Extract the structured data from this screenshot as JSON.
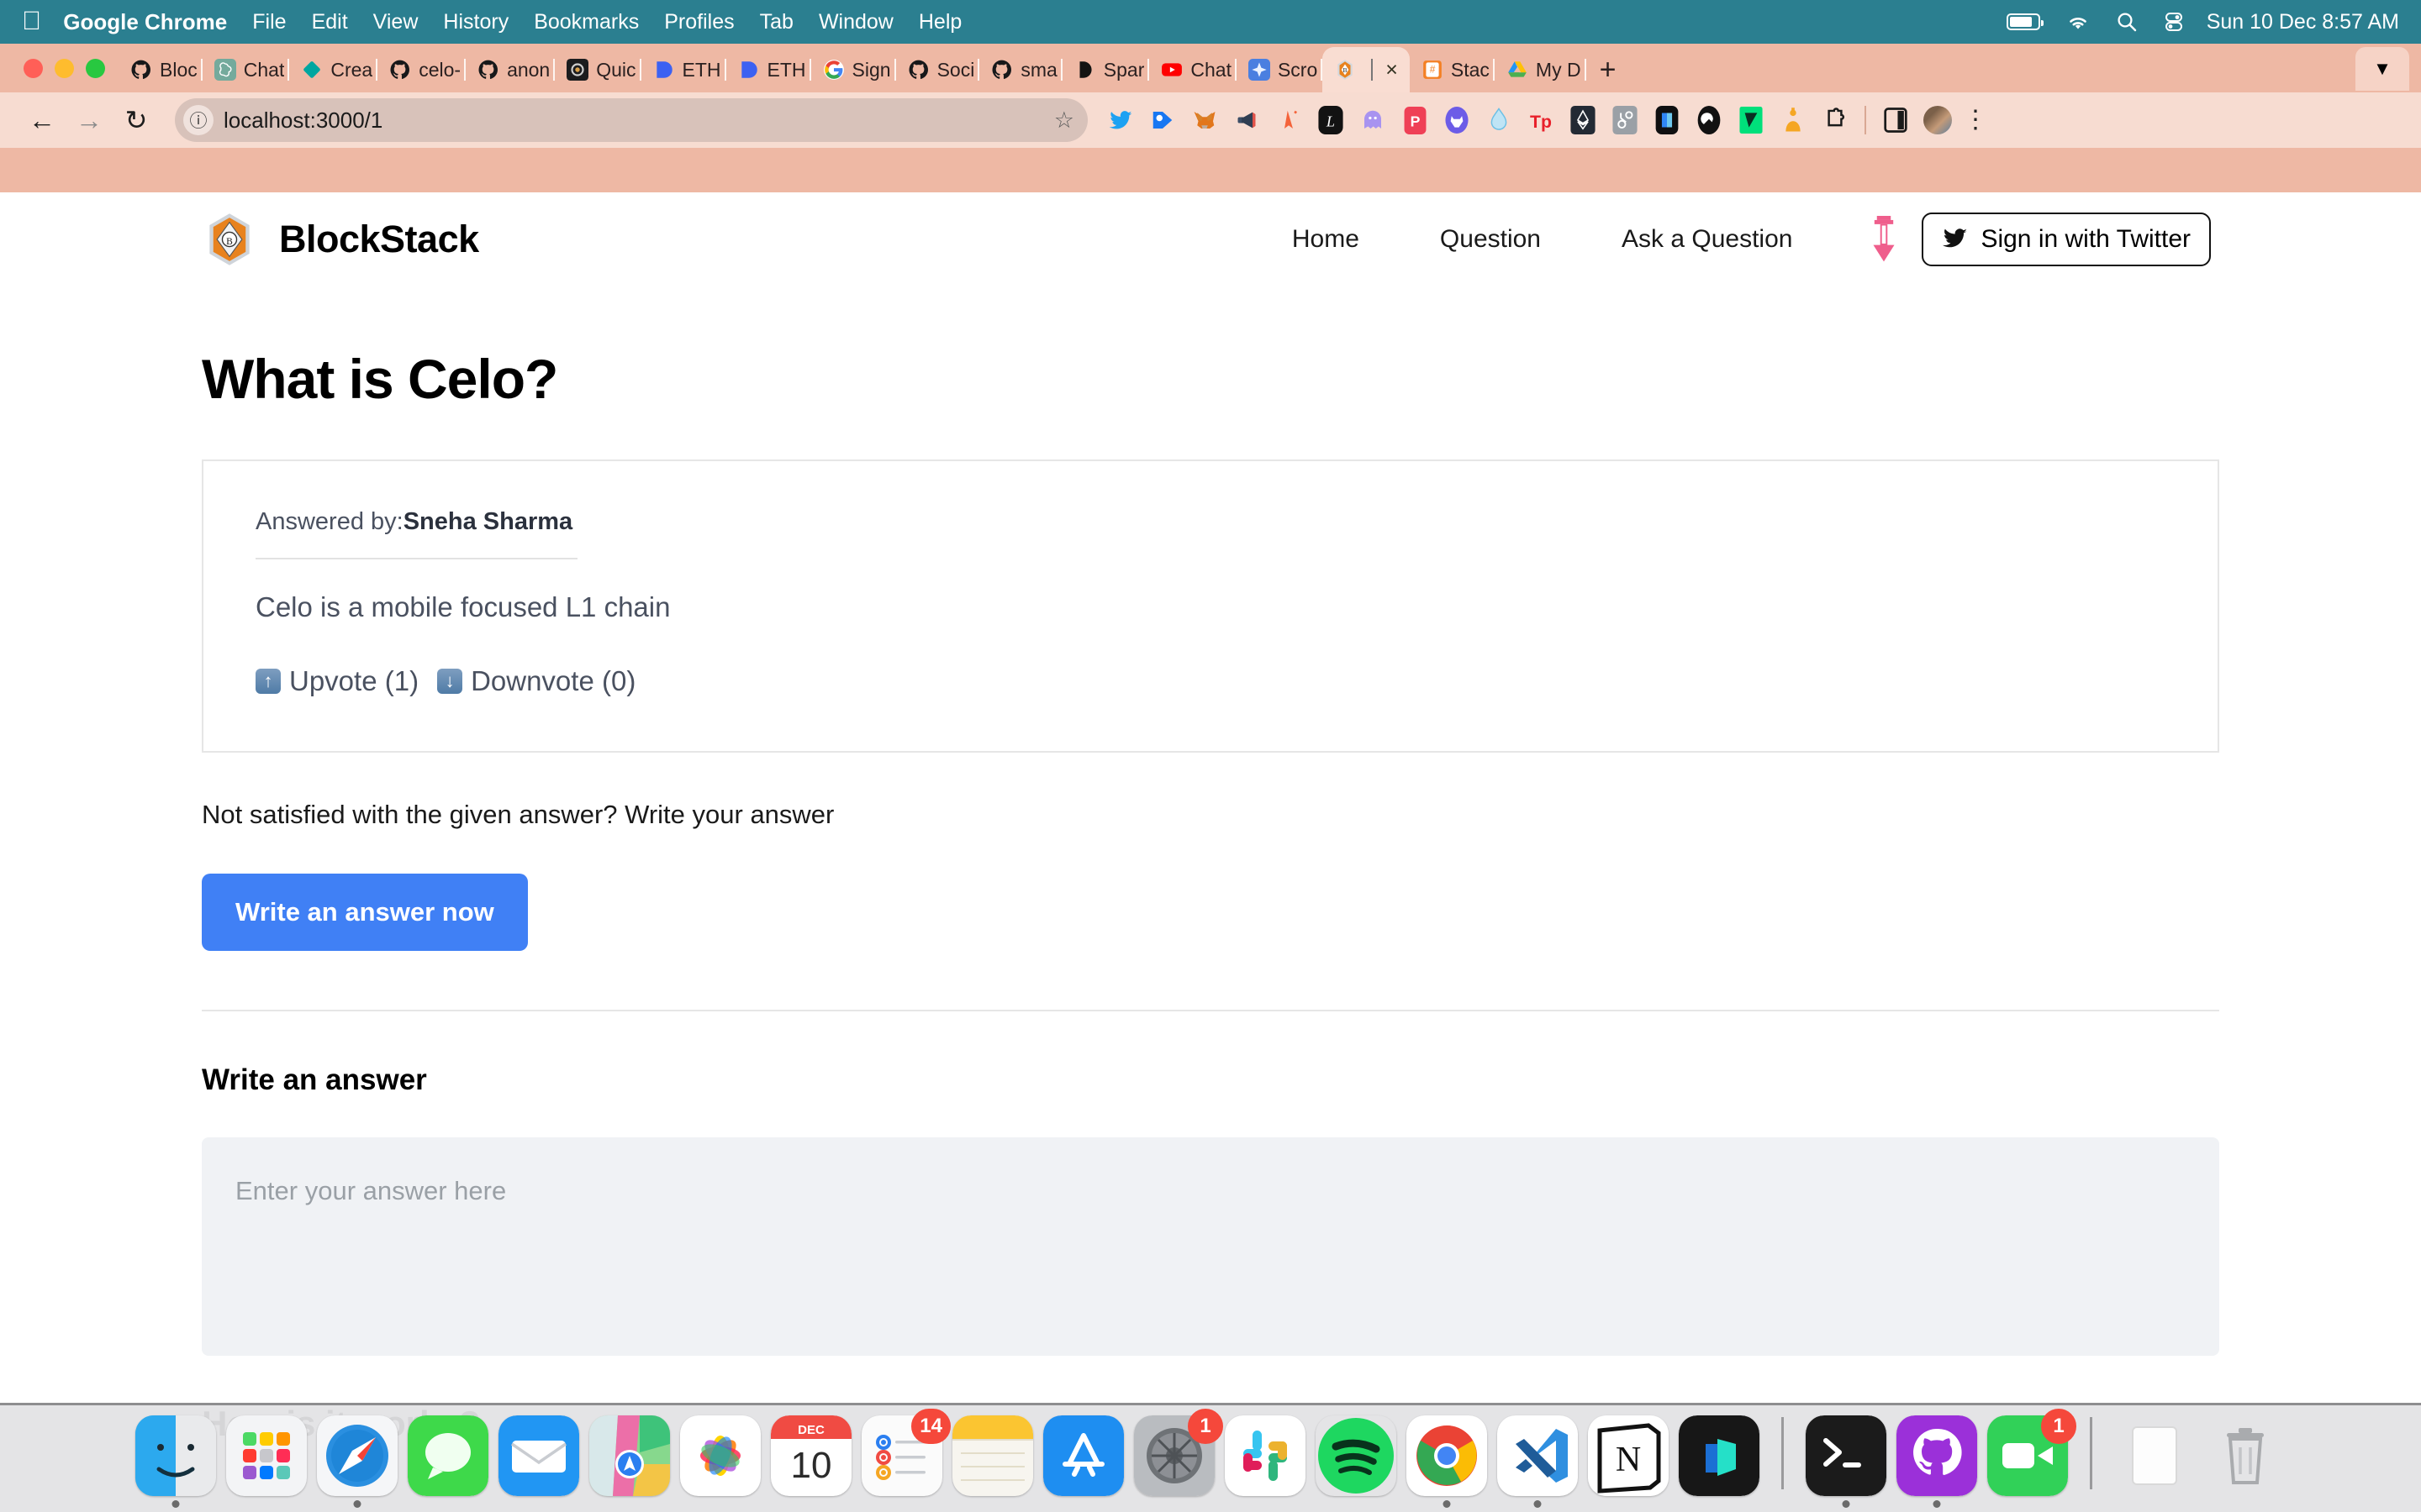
{
  "menubar": {
    "apple_icon": "apple-icon",
    "items": [
      "Google Chrome",
      "File",
      "Edit",
      "View",
      "History",
      "Bookmarks",
      "Profiles",
      "Tab",
      "Window",
      "Help"
    ],
    "status_icons": [
      "battery-icon",
      "wifi-icon",
      "search-icon",
      "control-center-icon"
    ],
    "clock": "Sun 10 Dec  8:57 AM",
    "bg_color": "#2b7f90"
  },
  "browser": {
    "window_controls": [
      "close-button",
      "minimize-button",
      "maximize-button"
    ],
    "tabs": [
      {
        "title": "Bloc",
        "favicon": "github-icon",
        "active": false
      },
      {
        "title": "Chat",
        "favicon": "openai-icon",
        "active": false
      },
      {
        "title": "Crea",
        "favicon": "diamond-icon",
        "active": false
      },
      {
        "title": "celo-",
        "favicon": "github-icon",
        "active": false
      },
      {
        "title": "anon",
        "favicon": "github-icon",
        "active": false
      },
      {
        "title": "Quic",
        "favicon": "dark-app-icon",
        "active": false
      },
      {
        "title": "ETH",
        "favicon": "blue-blob-icon",
        "active": false
      },
      {
        "title": "ETH",
        "favicon": "blue-blob-icon",
        "active": false
      },
      {
        "title": "Sign",
        "favicon": "google-icon",
        "active": false
      },
      {
        "title": "Soci",
        "favicon": "github-icon",
        "active": false
      },
      {
        "title": "sma",
        "favicon": "github-icon",
        "active": false
      },
      {
        "title": "Spar",
        "favicon": "anthropic-icon",
        "active": false
      },
      {
        "title": "Chat",
        "favicon": "youtube-icon",
        "active": false
      },
      {
        "title": "Scro",
        "favicon": "blue-star-icon",
        "active": false
      },
      {
        "title": "",
        "favicon": "blockstack-icon",
        "active": true
      },
      {
        "title": "Stac",
        "favicon": "stackoverflow-icon",
        "active": false
      },
      {
        "title": "My D",
        "favicon": "google-drive-icon",
        "active": false
      }
    ],
    "new_tab_label": "+",
    "tab_close_label": "×",
    "tab_search_icon": "chevron-down-icon",
    "toolbar": {
      "back_icon": "back-arrow-icon",
      "forward_icon": "forward-arrow-icon",
      "reload_icon": "reload-icon",
      "site_info_icon": "info-icon",
      "url": "localhost:3000/1",
      "bookmark_icon": "star-icon",
      "extensions": [
        "twitter-icon",
        "pricetag-icon",
        "metamask-fox-icon",
        "megaphone-icon",
        "orange-ribbon-icon",
        "letter-l-icon",
        "ghost-icon",
        "pocket-icon",
        "wolf-icon",
        "water-drop-icon",
        "tp-icon",
        "ethereum-badge-icon",
        "hubspot-icon",
        "book-icon",
        "swirl-icon",
        "green-check-icon",
        "honey-icon",
        "puzzle-icon"
      ],
      "sidepanel_icon": "side-panel-icon",
      "profile_icon": "avatar",
      "menu_icon": "kebab-menu-icon"
    }
  },
  "site": {
    "logo_icon": "blockstack-gem-logo",
    "brand": "BlockStack",
    "nav": [
      {
        "label": "Home",
        "name": "nav-home"
      },
      {
        "label": "Question",
        "name": "nav-question"
      },
      {
        "label": "Ask a Question",
        "name": "nav-ask-a-question"
      }
    ],
    "pin_icon": "pink-pin-icon",
    "signin": {
      "label": "Sign in with Twitter",
      "icon": "twitter-bird-icon"
    }
  },
  "main": {
    "question_title": "What is Celo?",
    "answer": {
      "answered_by_label": "Answered by:",
      "author": "Sneha Sharma",
      "body": "Celo is a mobile focused L1 chain",
      "upvote_label": "Upvote (1)",
      "upvote_icon": "arrow-up-icon",
      "downvote_label": "Downvote (0)",
      "downvote_icon": "arrow-down-icon"
    },
    "not_satisfied": "Not satisfied with the given answer? Write your answer",
    "write_button": "Write an answer now",
    "write_heading": "Write an answer",
    "answer_placeholder": "Enter your answer here",
    "answer_value": "",
    "next_heading": "How is it works?",
    "accent_color": "#4080f5"
  },
  "dock": {
    "items": [
      {
        "name": "finder",
        "badge": null,
        "running": true
      },
      {
        "name": "launchpad",
        "badge": null,
        "running": false
      },
      {
        "name": "safari",
        "badge": null,
        "running": true
      },
      {
        "name": "messages",
        "badge": null,
        "running": false
      },
      {
        "name": "mail",
        "badge": null,
        "running": false
      },
      {
        "name": "maps",
        "badge": null,
        "running": false
      },
      {
        "name": "photos",
        "badge": null,
        "running": false
      },
      {
        "name": "calendar",
        "badge": null,
        "running": false,
        "month": "DEC",
        "day": "10"
      },
      {
        "name": "reminders",
        "badge": "14",
        "running": false
      },
      {
        "name": "notes",
        "badge": null,
        "running": false
      },
      {
        "name": "app-store",
        "badge": null,
        "running": false
      },
      {
        "name": "system-preferences",
        "badge": "1",
        "running": false
      },
      {
        "name": "slack",
        "badge": null,
        "running": false
      },
      {
        "name": "spotify",
        "badge": null,
        "running": false
      },
      {
        "name": "chrome",
        "badge": null,
        "running": true
      },
      {
        "name": "vs-code",
        "badge": null,
        "running": true
      },
      {
        "name": "notion",
        "badge": null,
        "running": false
      },
      {
        "name": "linear",
        "badge": null,
        "running": false
      },
      {
        "name": "terminal",
        "badge": null,
        "running": true
      },
      {
        "name": "github-desktop",
        "badge": null,
        "running": true
      },
      {
        "name": "facetime",
        "badge": "1",
        "running": false
      },
      {
        "name": "documents-stack",
        "badge": null,
        "running": false
      },
      {
        "name": "trash",
        "badge": null,
        "running": false
      }
    ]
  }
}
